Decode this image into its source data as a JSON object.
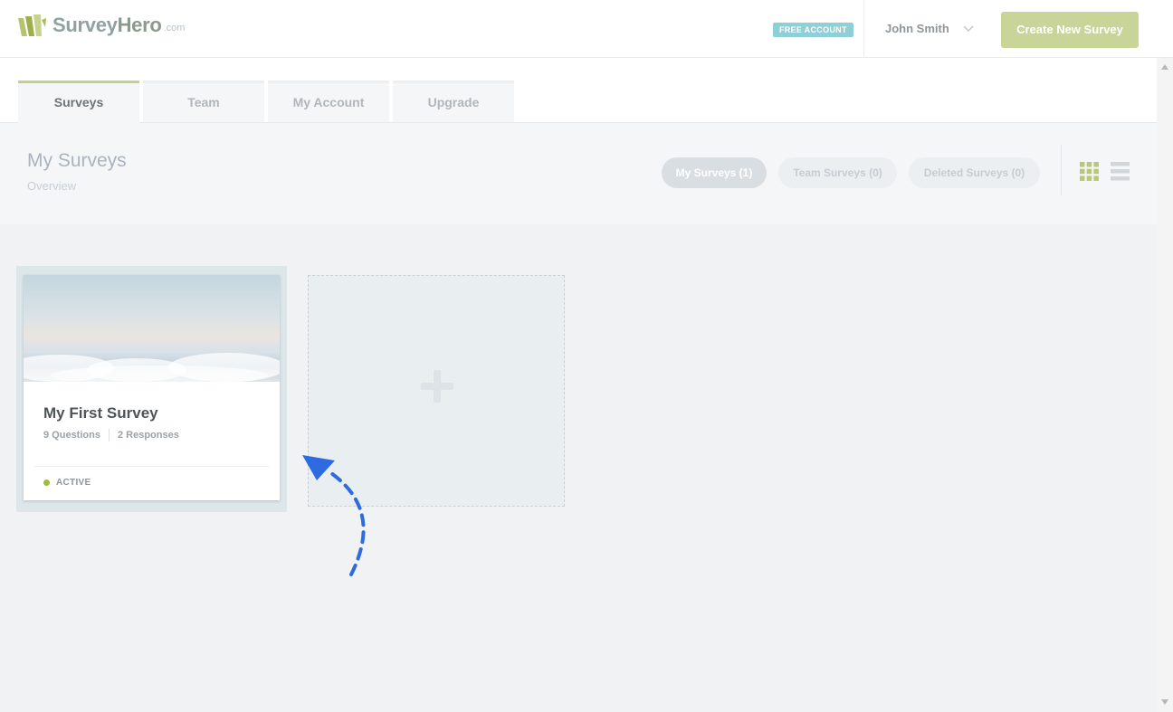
{
  "brand": {
    "name_part1": "Survey",
    "name_part2": "Hero",
    "suffix": ".com"
  },
  "header": {
    "account_badge": "FREE ACCOUNT",
    "user_name": "John Smith",
    "create_button": "Create New Survey"
  },
  "tabs": [
    {
      "label": "Surveys",
      "active": true
    },
    {
      "label": "Team",
      "active": false
    },
    {
      "label": "My Account",
      "active": false
    },
    {
      "label": "Upgrade",
      "active": false
    }
  ],
  "page": {
    "title": "My Surveys",
    "subtitle": "Overview",
    "filters": [
      {
        "label": "My Surveys (1)",
        "active": true
      },
      {
        "label": "Team Surveys (0)",
        "active": false
      },
      {
        "label": "Deleted Surveys (0)",
        "active": false
      }
    ]
  },
  "surveys": [
    {
      "title": "My First Survey",
      "questions": "9 Questions",
      "responses": "2 Responses",
      "status": "ACTIVE"
    }
  ],
  "colors": {
    "accent": "#c9d499",
    "badge": "#8fd0d6",
    "status_active": "#9bbc3d",
    "annotation_arrow": "#2f6be0"
  },
  "icons": [
    "logo-icon",
    "chevron-down-icon",
    "grid-view-icon",
    "list-view-icon",
    "plus-icon",
    "annotation-arrow-icon"
  ]
}
